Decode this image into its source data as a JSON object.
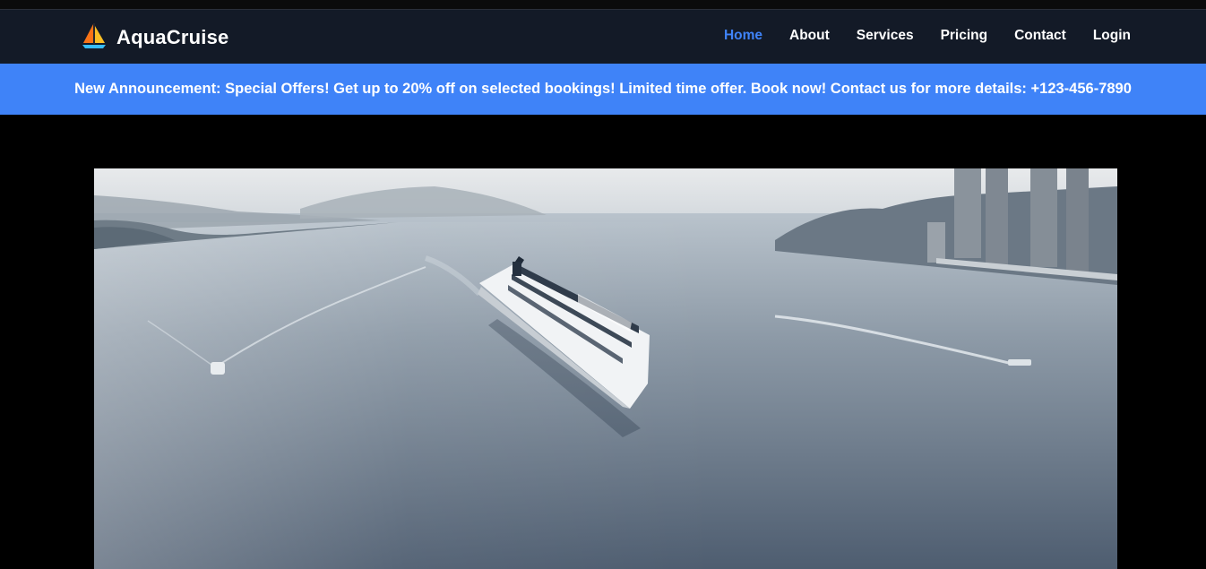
{
  "brand": {
    "name": "AquaCruise",
    "logo_icon": "sailboat-icon"
  },
  "nav": {
    "items": [
      {
        "label": "Home",
        "active": true
      },
      {
        "label": "About",
        "active": false
      },
      {
        "label": "Services",
        "active": false
      },
      {
        "label": "Pricing",
        "active": false
      },
      {
        "label": "Contact",
        "active": false
      },
      {
        "label": "Login",
        "active": false
      }
    ]
  },
  "announcement": {
    "text": "New Announcement: Special Offers! Get up to 20% off on selected bookings! Limited time offer. Book now! Contact us for more details: +123-456-7890"
  },
  "hero": {
    "image": "cruise-ship-aerial-photo"
  },
  "colors": {
    "navbar_bg": "#131a27",
    "accent": "#3f83f8",
    "page_bg": "#000000"
  }
}
